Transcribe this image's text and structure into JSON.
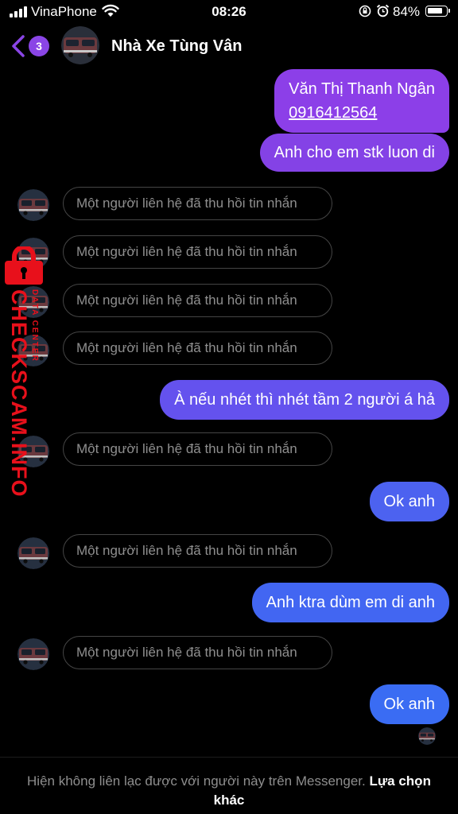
{
  "status_bar": {
    "carrier": "VinaPhone",
    "time": "08:26",
    "battery": "84%",
    "battery_level": 0.84,
    "icons": [
      "signal-icon",
      "wifi-icon",
      "orientation-lock-icon",
      "alarm-icon",
      "battery-icon"
    ]
  },
  "header": {
    "back_badge": "3",
    "contact_name": "Nhà Xe Tùng Vân",
    "accent_color": "#8a45e6"
  },
  "messages": [
    {
      "direction": "out",
      "lines": [
        "Văn Thị Thanh Ngân",
        "0916412564"
      ],
      "color": "#8c3fe8"
    },
    {
      "direction": "out",
      "text": "Anh cho em stk luon di",
      "color": "#8442e6"
    },
    {
      "direction": "in",
      "text": "Một người liên hệ đã thu hồi tin nhắn"
    },
    {
      "direction": "in",
      "text": "Một người liên hệ đã thu hồi tin nhắn"
    },
    {
      "direction": "in",
      "text": "Một người liên hệ đã thu hồi tin nhắn"
    },
    {
      "direction": "in",
      "text": "Một người liên hệ đã thu hồi tin nhắn"
    },
    {
      "direction": "out",
      "text": "À nếu nhét thì nhét tầm 2 người á hả",
      "color": "#6452ee"
    },
    {
      "direction": "in",
      "text": "Một người liên hệ đã thu hồi tin nhắn"
    },
    {
      "direction": "out",
      "text": "Ok anh",
      "color": "#4c62f0"
    },
    {
      "direction": "in",
      "text": "Một người liên hệ đã thu hồi tin nhắn"
    },
    {
      "direction": "out",
      "text": "Anh ktra dùm em di anh",
      "color": "#4266f2"
    },
    {
      "direction": "in",
      "text": "Một người liên hệ đã thu hồi tin nhắn"
    },
    {
      "direction": "out",
      "text": "Ok anh",
      "color": "#3a6cf3"
    }
  ],
  "watermark": {
    "main": "CHECKSCAM.INFO",
    "sub": "DATA CENTER",
    "color": "#e8101b"
  },
  "footer": {
    "text": "Hiện không liên lạc được với người này trên Messenger.",
    "link": "Lựa chọn khác"
  }
}
